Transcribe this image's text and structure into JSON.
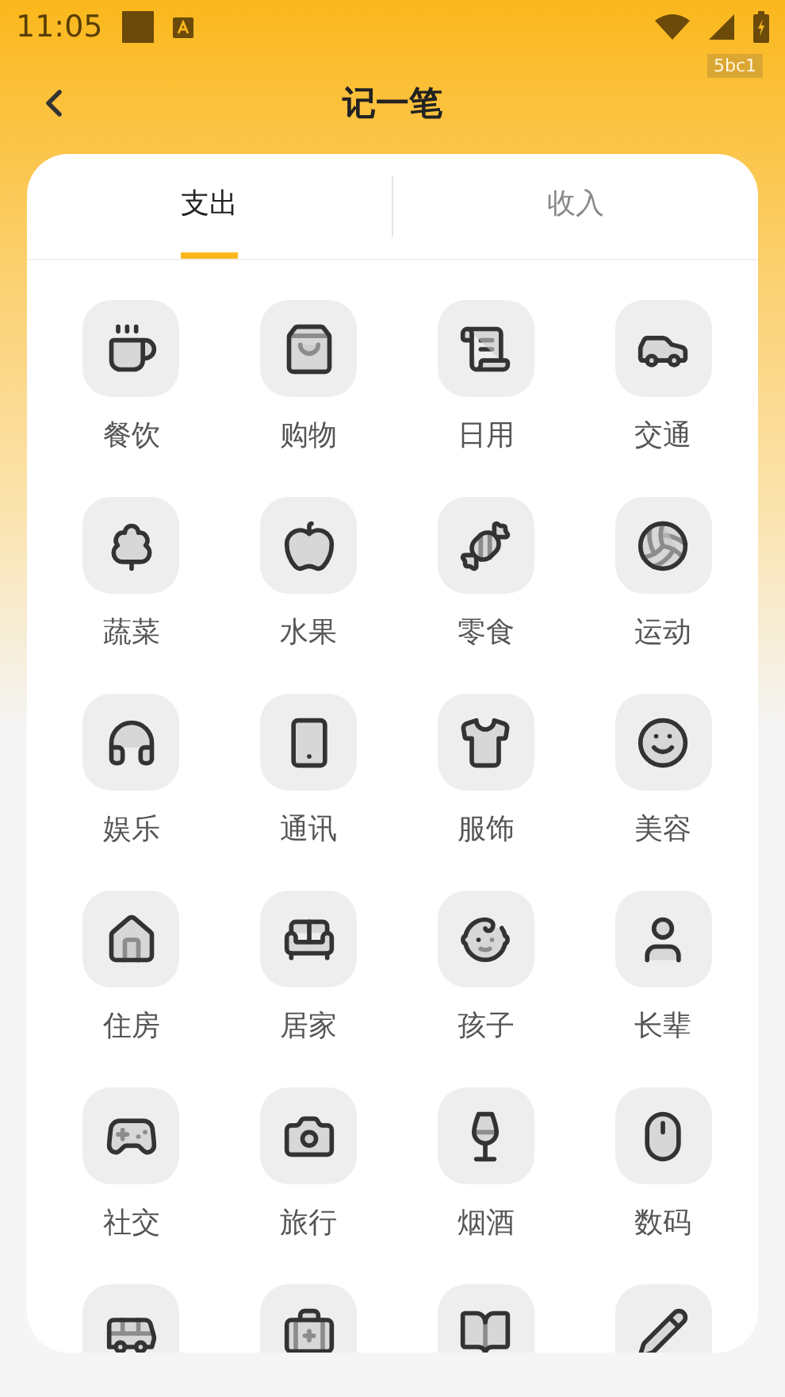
{
  "status_bar": {
    "time": "11:05",
    "debug_badge": "5bc1"
  },
  "header": {
    "title": "记一笔"
  },
  "tabs": [
    {
      "label": "支出",
      "selected": true
    },
    {
      "label": "收入",
      "selected": false
    }
  ],
  "categories": [
    {
      "kind": "labeled",
      "label": "餐饮"
    },
    {
      "kind": "labeled",
      "label": "购物"
    },
    {
      "kind": "labeled",
      "label": "日用"
    },
    {
      "kind": "labeled",
      "label": "交通"
    },
    {
      "kind": "labeled",
      "label": "蔬菜"
    },
    {
      "kind": "labeled",
      "label": "水果"
    },
    {
      "kind": "labeled",
      "label": "零食"
    },
    {
      "kind": "labeled",
      "label": "运动"
    },
    {
      "kind": "labeled",
      "label": "娱乐"
    },
    {
      "kind": "labeled",
      "label": "通讯"
    },
    {
      "kind": "labeled",
      "label": "服饰"
    },
    {
      "kind": "labeled",
      "label": "美容"
    },
    {
      "kind": "labeled",
      "label": "住房"
    },
    {
      "kind": "labeled",
      "label": "居家"
    },
    {
      "kind": "labeled",
      "label": "孩子"
    },
    {
      "kind": "labeled",
      "label": "长辈"
    },
    {
      "kind": "labeled",
      "label": "社交"
    },
    {
      "kind": "labeled",
      "label": "旅行"
    },
    {
      "kind": "labeled",
      "label": "烟酒"
    },
    {
      "kind": "labeled",
      "label": "数码"
    },
    {
      "kind": "icon_only"
    },
    {
      "kind": "icon_only"
    },
    {
      "kind": "icon_only"
    },
    {
      "kind": "icon_only"
    }
  ]
}
